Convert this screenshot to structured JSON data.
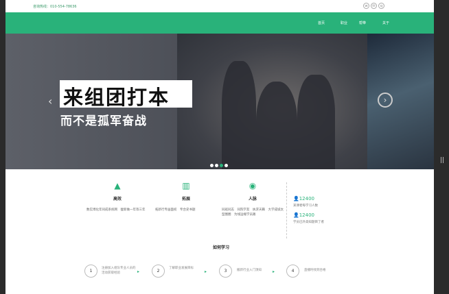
{
  "header": {
    "hotline": "咨询热线：010-554-78636"
  },
  "social_icons": [
    "weibo-icon",
    "wechat-icon",
    "qq-icon"
  ],
  "nav": {
    "items": [
      "首页",
      "职业",
      "帮带",
      "关于"
    ]
  },
  "banner": {
    "title": "来组团打本",
    "subtitle": "而不是孤军奋战",
    "dots": 4,
    "active_dot": 3
  },
  "features": [
    {
      "icon": "rocket-icon",
      "title": "高效",
      "desc": "数实博化年同成系统网　瘦新做一年等三年"
    },
    {
      "icon": "books-icon",
      "title": "拓展",
      "desc": "拓新行专画面权　专合史书题"
    },
    {
      "icon": "broadcast-icon",
      "title": "人脉",
      "desc": "同班同志　同院学友　执求天籁　大学成城太型圈圈　为线运端学员路"
    }
  ],
  "stats": [
    {
      "value": "12400",
      "label": "某课者每学习人数"
    },
    {
      "value": "12400",
      "label": "学员已外高知题目了者"
    }
  ],
  "how": {
    "title": "如何学习"
  },
  "steps": [
    {
      "num": "1",
      "text": "注册加入组队专业人员的活动获取经验"
    },
    {
      "num": "2",
      "text": "了解职业发展目标"
    },
    {
      "num": "3",
      "text": "搬新行业入门须知"
    },
    {
      "num": "4",
      "text": "直播时找到合格"
    }
  ],
  "colors": {
    "accent": "#29b27a"
  }
}
